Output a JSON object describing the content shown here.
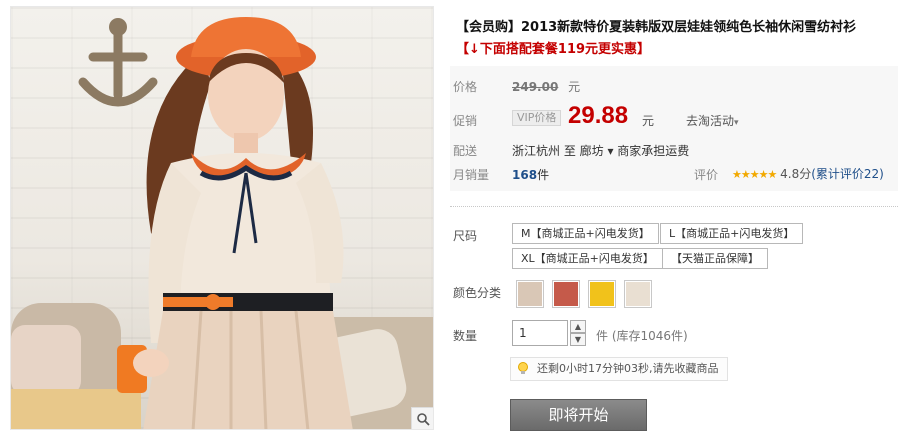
{
  "product": {
    "title": "【会员购】2013新款特价夏装韩版双层娃娃领纯色长袖休闲雪纺衬衫",
    "promo": "【↓下面搭配套餐119元更实惠】"
  },
  "price": {
    "orig_label": "价格",
    "orig_value": "249.00",
    "orig_unit": "元",
    "sale_label": "促销",
    "vip_tag": "VIP价格",
    "sale_value": "29.88",
    "sale_unit": "元",
    "sale_extra": "去淘活动"
  },
  "shipping": {
    "label": "配送",
    "text": "浙江杭州 至 廊坊 ▾ 商家承担运费"
  },
  "sales": {
    "label": "月销量",
    "count": "168",
    "unit": "件",
    "rating_label": "评价",
    "stars": "★★★★★",
    "score": "4.8分",
    "review_count": "(累计评价22)"
  },
  "sku": {
    "size_label": "尺码",
    "sizes": [
      "M【商城正品+闪电发货】",
      "L【商城正品+闪电发货】",
      "XL【商城正品+闪电发货】",
      "【天猫正品保障】"
    ],
    "color_label": "颜色分类",
    "swatch_colors": [
      "#d9c7b6",
      "#c55a4a",
      "#f1c21b",
      "#e9dfd2"
    ]
  },
  "quantity": {
    "label": "数量",
    "value": "1",
    "stock": "件 (库存1046件)"
  },
  "timer": {
    "text": "还剩0小时17分钟03秒,请先收藏商品"
  },
  "buy_button": "即将开始",
  "colors": {
    "price_red": "#c40000",
    "star_gold": "#f2a900",
    "link_blue": "#1f4f8a"
  }
}
